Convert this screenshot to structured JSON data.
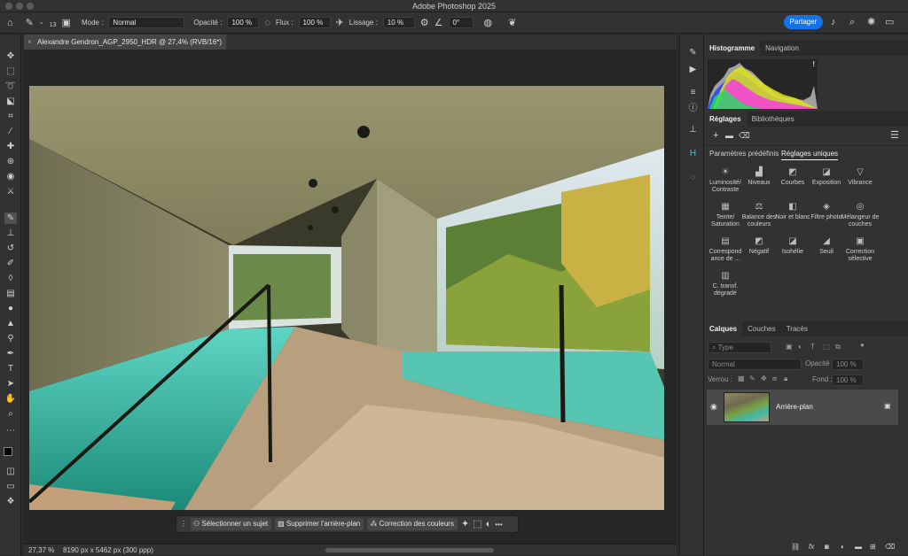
{
  "app": {
    "title": "Adobe Photoshop 2025"
  },
  "options": {
    "brush_size": "13",
    "mode_label": "Mode :",
    "mode_value": "Normal",
    "opacity_label": "Opacité :",
    "opacity_value": "100 %",
    "flow_label": "Flux :",
    "flow_value": "100 %",
    "smoothing_label": "Lissage :",
    "smoothing_value": "10 %",
    "angle_value": "0°",
    "share_label": "Partager"
  },
  "document": {
    "tab_title": "Alexandre Gendron_AGP_2950_HDR @ 27,4% (RVB/16*) *",
    "close_glyph": "×"
  },
  "context_bar": {
    "select_subject": "Sélectionner un sujet",
    "remove_background": "Supprimer l'arrière-plan",
    "color_correction": "Correction des couleurs",
    "more": "•••"
  },
  "status": {
    "zoom": "27,37 %",
    "dimensions": "8190 px x 5462 px (300 ppp)"
  },
  "histogram_panel": {
    "tabs": [
      "Histogramme",
      "Navigation"
    ],
    "warning": "!"
  },
  "adjustments_panel": {
    "tabs": [
      "Réglages",
      "Bibliothèques"
    ],
    "subtabs": [
      "Paramètres prédéfinis",
      "Réglages uniques"
    ],
    "items": [
      {
        "label": "Luminosité/ Contraste",
        "icon": "brightness-icon",
        "glyph": "☀"
      },
      {
        "label": "Niveaux",
        "icon": "levels-icon",
        "glyph": "▟"
      },
      {
        "label": "Courbes",
        "icon": "curves-icon",
        "glyph": "◩"
      },
      {
        "label": "Exposition",
        "icon": "exposure-icon",
        "glyph": "◪"
      },
      {
        "label": "Vibrance",
        "icon": "vibrance-icon",
        "glyph": "▽"
      },
      {
        "label": "Teinte/ Saturation",
        "icon": "hue-icon",
        "glyph": "▦"
      },
      {
        "label": "Balance des couleurs",
        "icon": "color-balance-icon",
        "glyph": "⚖"
      },
      {
        "label": "Noir et blanc",
        "icon": "black-white-icon",
        "glyph": "◧"
      },
      {
        "label": "Filtre photo",
        "icon": "photo-filter-icon",
        "glyph": "◈"
      },
      {
        "label": "Mélangeur de couches",
        "icon": "channel-mixer-icon",
        "glyph": "◎"
      },
      {
        "label": "Correspond ance de ...",
        "icon": "color-lookup-icon",
        "glyph": "▤"
      },
      {
        "label": "Négatif",
        "icon": "invert-icon",
        "glyph": "◩"
      },
      {
        "label": "Isohélie",
        "icon": "posterize-icon",
        "glyph": "◪"
      },
      {
        "label": "Seuil",
        "icon": "threshold-icon",
        "glyph": "◢"
      },
      {
        "label": "Correction sélective",
        "icon": "selective-color-icon",
        "glyph": "▣"
      },
      {
        "label": "C. transf. dégradé",
        "icon": "gradient-map-icon",
        "glyph": "▥"
      }
    ]
  },
  "layers_panel": {
    "tabs": [
      "Calques",
      "Couches",
      "Tracés"
    ],
    "filter_label": "Type",
    "blend_mode": "Normal",
    "opacity_label": "Opacité :",
    "opacity_value": "100 %",
    "lock_label": "Verrou :",
    "fill_label": "Fond :",
    "fill_value": "100 %",
    "layer_name": "Arrière-plan",
    "bottom_fx": "fx"
  },
  "colors": {
    "accent": "#1473e6",
    "panel": "#323232",
    "dark": "#262626"
  }
}
